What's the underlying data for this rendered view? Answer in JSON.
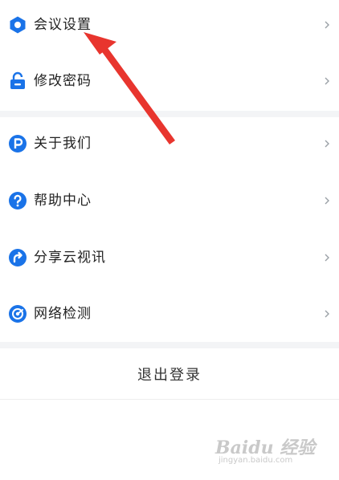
{
  "menu": {
    "items": [
      {
        "label": "会议设置",
        "icon": "settings-hex-icon"
      },
      {
        "label": "修改密码",
        "icon": "lock-icon"
      },
      {
        "label": "关于我们",
        "icon": "p-badge-icon"
      },
      {
        "label": "帮助中心",
        "icon": "question-icon"
      },
      {
        "label": "分享云视讯",
        "icon": "share-icon"
      },
      {
        "label": "网络检测",
        "icon": "network-icon"
      }
    ]
  },
  "logout": {
    "label": "退出登录"
  },
  "watermark": {
    "main": "Baidu 经验",
    "sub": "jingyan.baidu.com"
  },
  "colors": {
    "accent": "#1a73e8",
    "annotation_arrow": "#e8352e",
    "divider": "#f3f4f6"
  }
}
